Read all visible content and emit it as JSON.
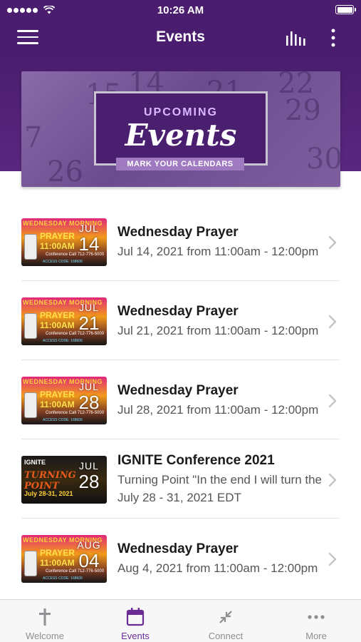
{
  "status": {
    "time": "10:26 AM"
  },
  "nav": {
    "title": "Events"
  },
  "banner": {
    "upcoming": "UPCOMING",
    "events": "Events",
    "tagline": "MARK YOUR CALENDARS"
  },
  "events": [
    {
      "name": "Wednesday Prayer",
      "subtitle": "Jul 14, 2021 from 11:00am - 12:00pm",
      "subtitle2": "",
      "month": "JUL",
      "day": "14",
      "thumb": "prayer"
    },
    {
      "name": "Wednesday Prayer",
      "subtitle": "Jul 21, 2021 from 11:00am - 12:00pm",
      "subtitle2": "",
      "month": "JUL",
      "day": "21",
      "thumb": "prayer"
    },
    {
      "name": "Wednesday Prayer",
      "subtitle": "Jul 28, 2021 from 11:00am - 12:00pm",
      "subtitle2": "",
      "month": "JUL",
      "day": "28",
      "thumb": "prayer"
    },
    {
      "name": "IGNITE Conference 2021",
      "subtitle": "Turning Point \"In the end I will turn the",
      "subtitle2": "July 28 - 31, 2021 EDT",
      "month": "JUL",
      "day": "28",
      "thumb": "ignite"
    },
    {
      "name": "Wednesday Prayer",
      "subtitle": "Aug 4, 2021 from 11:00am - 12:00pm",
      "subtitle2": "",
      "month": "AUG",
      "day": "04",
      "thumb": "prayer"
    }
  ],
  "thumb_text": {
    "prayer_title": "WEDNESDAY MORNING",
    "prayer_word": "PRAYER 11:00AM",
    "prayer_info": "Conference Call 712-776-5000",
    "prayer_access": "ACCESS CODE: 168606",
    "ignite_title": "IGNITE",
    "ignite_tp": "TURNING POINT",
    "ignite_date": "July 28-31, 2021"
  },
  "tabs": [
    {
      "label": "Welcome",
      "icon": "cross-icon",
      "active": false
    },
    {
      "label": "Events",
      "icon": "calendar-icon",
      "active": true
    },
    {
      "label": "Connect",
      "icon": "connect-arrows-icon",
      "active": false
    },
    {
      "label": "More",
      "icon": "more-dots-icon",
      "active": false
    }
  ],
  "colors": {
    "brand": "#4a1d6e",
    "accent": "#6a2b95"
  }
}
